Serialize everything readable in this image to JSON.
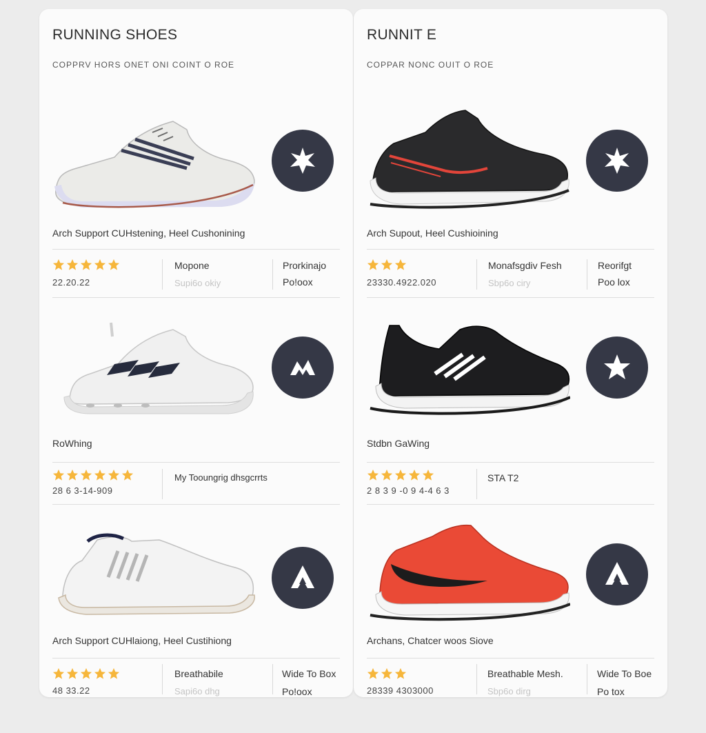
{
  "colors": {
    "badge": "#353846",
    "star": "#F6B63B",
    "panel": "#FBFBFB",
    "background": "#ECECEC"
  },
  "left": {
    "title": "RUNNING SHOES",
    "subtitle": "COPPRV HORS ONET ONI COINT O ROE",
    "products": [
      {
        "shoe_icon": "white-grey-running-shoe",
        "badge_icon": "starburst-icon",
        "feature": "Arch Support CUHstening,  Heel Cushonining",
        "stars": 5,
        "code": "22.20.22",
        "spec_a": "Mopone",
        "spec_b": "Supi6o okiy",
        "spec_c": "Prorkinajo",
        "spec_d": "Po!oox"
      },
      {
        "shoe_icon": "white-black-stripe-shoe",
        "badge_icon": "mountain-icon",
        "feature": "RoWhing",
        "stars": 6,
        "code": "28 6 3-14-909",
        "spec_a": "My  Tooungrig dhsgcrrts",
        "spec_b": "",
        "spec_c": "",
        "spec_d": ""
      },
      {
        "shoe_icon": "white-silver-shoe",
        "badge_icon": "peak-icon",
        "feature": "Arch Support CUHlaiong,  Heel Custihiong",
        "stars": 5,
        "code": "48 33.22",
        "spec_a": "Breathabile",
        "spec_b": "Sapi6o dhg",
        "spec_c": "Wide To Box",
        "spec_d": "Po!oox"
      }
    ]
  },
  "right": {
    "title": "RUNNIT E",
    "subtitle": "COPPAR  NONC OUIT O ROE",
    "products": [
      {
        "shoe_icon": "black-red-running-shoe",
        "badge_icon": "starburst-icon",
        "feature": "Arch Supout, Heel Cushioining",
        "stars": 3,
        "code": "23330.4922.020",
        "spec_a": "Monafsgdiv Fesh",
        "spec_b": "Sbp6o ciry",
        "spec_c": "Reorifgt",
        "spec_d": "Poo lox"
      },
      {
        "shoe_icon": "black-white-stripe-shoe",
        "badge_icon": "star-icon",
        "feature": "Stdbn GaWing",
        "stars": 5,
        "code": "2 8 3 9 -0 9 4-4 6 3",
        "spec_a": "STA T2",
        "spec_b": "",
        "spec_c": "",
        "spec_d": ""
      },
      {
        "shoe_icon": "red-swoosh-shoe",
        "badge_icon": "peak-icon",
        "feature": "Archans,  Chatcer woos Siove",
        "stars": 3,
        "code": "28339 4303000",
        "spec_a": "Breathable Mesh.",
        "spec_b": "Sbp6o dirg",
        "spec_c": "Wide To Boe",
        "spec_d": "Po tox"
      }
    ]
  }
}
